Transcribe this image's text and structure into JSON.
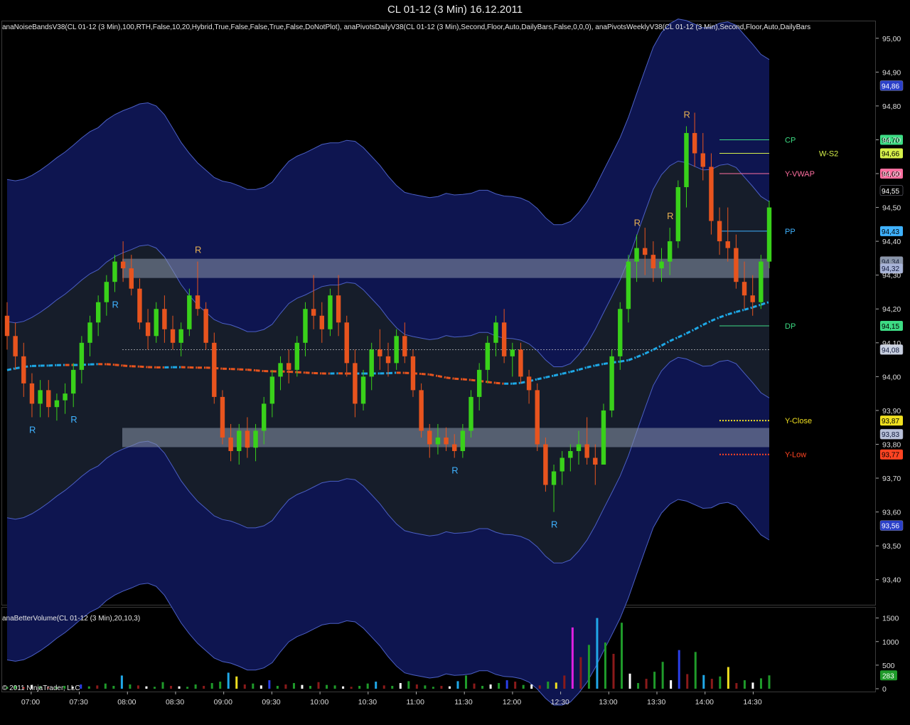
{
  "window": {
    "title": "CL 01-12 (3 Min)  16.12.2011"
  },
  "price_panel": {
    "indicator_label": "anaNoiseBandsV38(CL 01-12 (3 Min),100,RTH,False,10,20,Hybrid,True,False,False,True,False,DoNotPlot), anaPivotsDailyV38(CL 01-12 (3 Min),Second,Floor,Auto,DailyBars,False,0,0,0), anaPivotsWeeklyV38(CL 01-12 (3 Min),Second,Floor,Auto,DailyBars"
  },
  "volume_panel": {
    "indicator_label": "anaBetterVolume(CL 01-12 (3 Min),20,10,3)",
    "copyright": "© 2011 NinjaTrader, LLC"
  },
  "colors": {
    "background": "#000000",
    "band_fill": "#0e1550",
    "band_line": "#4b5fc4",
    "inner_fill": "#161d2a",
    "vwap_up": "#1ea8e6",
    "vwap_down": "#e8541e",
    "candle_up": "#39d11a",
    "candle_down": "#e8541e",
    "zone_fill": "#8a96aa"
  },
  "chart_data": [
    {
      "type": "candlestick",
      "panel": "price",
      "x_unit": "time",
      "x_ticks": [
        "07:00",
        "07:30",
        "08:00",
        "08:30",
        "09:00",
        "09:30",
        "10:00",
        "10:30",
        "11:00",
        "11:30",
        "12:00",
        "12:30",
        "13:00",
        "13:30",
        "14:00",
        "14:30"
      ],
      "y_ticks": [
        "95,00",
        "94,90",
        "94,80",
        "94,70",
        "94,60",
        "94,50",
        "94,40",
        "94,30",
        "94,20",
        "94,10",
        "94,00",
        "93,90",
        "93,80",
        "93,70",
        "93,60",
        "93,50",
        "93,40"
      ],
      "ylim": [
        93.33,
        95.05
      ],
      "xlim_minutes": [
        405,
        880
      ],
      "key_levels": [
        {
          "label": "CP",
          "value": 94.7,
          "price_tag": "94,70",
          "color": "#3ddc84",
          "style": "solid"
        },
        {
          "label": "W-S2",
          "value": 94.66,
          "price_tag": "94,66",
          "color": "#d6f04a",
          "style": "solid"
        },
        {
          "label": "Y-VWAP",
          "value": 94.6,
          "price_tag": "94,60",
          "color": "#ff6fa0",
          "style": "solid"
        },
        {
          "label": "PP",
          "value": 94.43,
          "price_tag": "94,43",
          "color": "#3fb2ff",
          "style": "solid"
        },
        {
          "label": "DP",
          "value": 94.15,
          "price_tag": "94,15",
          "color": "#3ddc84",
          "style": "solid"
        },
        {
          "label": "Y-Close",
          "value": 93.87,
          "price_tag": "93,87",
          "color": "#f0e020",
          "style": "dotted"
        },
        {
          "label": "Y-Low",
          "value": 93.77,
          "price_tag": "93,77",
          "color": "#ff4422",
          "style": "dotted"
        }
      ],
      "price_tags": [
        {
          "text": "94,86",
          "value": 94.86,
          "bg": "#2a3fc8",
          "fg": "#ffffff"
        },
        {
          "text": "94,55",
          "value": 94.55,
          "bg": "#000000",
          "fg": "#ffffff"
        },
        {
          "text": "94,34",
          "value": 94.34,
          "bg": "#8a96aa",
          "fg": "#1a2240"
        },
        {
          "text": "94,32",
          "value": 94.32,
          "bg": "#a8b4d8",
          "fg": "#10183a"
        },
        {
          "text": "94,08",
          "value": 94.08,
          "bg": "#c8d0e0",
          "fg": "#10183a"
        },
        {
          "text": "93,83",
          "value": 93.83,
          "bg": "#b8c0d8",
          "fg": "#10183a"
        },
        {
          "text": "93,56",
          "value": 93.56,
          "bg": "#2a3fc8",
          "fg": "#ffffff"
        }
      ],
      "zones": [
        {
          "from": 94.3,
          "to": 94.34
        },
        {
          "from": 93.8,
          "to": 93.84
        }
      ],
      "reference_line": 94.08,
      "series": [
        {
          "open": 94.18,
          "high": 94.22,
          "low": 94.08,
          "close": 94.12
        },
        {
          "open": 94.12,
          "high": 94.16,
          "low": 94.02,
          "close": 94.06
        },
        {
          "open": 94.06,
          "high": 94.1,
          "low": 93.94,
          "close": 93.98
        },
        {
          "open": 93.98,
          "high": 94.01,
          "low": 93.88,
          "close": 93.92
        },
        {
          "open": 93.92,
          "high": 93.99,
          "low": 93.88,
          "close": 93.96
        },
        {
          "open": 93.96,
          "high": 93.99,
          "low": 93.88,
          "close": 93.91
        },
        {
          "open": 93.91,
          "high": 93.95,
          "low": 93.87,
          "close": 93.93
        },
        {
          "open": 93.93,
          "high": 93.98,
          "low": 93.89,
          "close": 93.95
        },
        {
          "open": 93.95,
          "high": 94.04,
          "low": 93.91,
          "close": 94.02
        },
        {
          "open": 94.02,
          "high": 94.12,
          "low": 93.98,
          "close": 94.1
        },
        {
          "open": 94.1,
          "high": 94.18,
          "low": 94.06,
          "close": 94.16
        },
        {
          "open": 94.16,
          "high": 94.24,
          "low": 94.12,
          "close": 94.22
        },
        {
          "open": 94.22,
          "high": 94.3,
          "low": 94.18,
          "close": 94.28
        },
        {
          "open": 94.28,
          "high": 94.36,
          "low": 94.25,
          "close": 94.34
        },
        {
          "open": 94.34,
          "high": 94.4,
          "low": 94.28,
          "close": 94.32
        },
        {
          "open": 94.32,
          "high": 94.36,
          "low": 94.24,
          "close": 94.26
        },
        {
          "open": 94.26,
          "high": 94.29,
          "low": 94.14,
          "close": 94.16
        },
        {
          "open": 94.16,
          "high": 94.2,
          "low": 94.08,
          "close": 94.12
        },
        {
          "open": 94.12,
          "high": 94.22,
          "low": 94.1,
          "close": 94.2
        },
        {
          "open": 94.2,
          "high": 94.24,
          "low": 94.1,
          "close": 94.14
        },
        {
          "open": 94.14,
          "high": 94.18,
          "low": 94.08,
          "close": 94.1
        },
        {
          "open": 94.1,
          "high": 94.16,
          "low": 94.06,
          "close": 94.14
        },
        {
          "open": 94.14,
          "high": 94.26,
          "low": 94.12,
          "close": 94.24
        },
        {
          "open": 94.24,
          "high": 94.34,
          "low": 94.18,
          "close": 94.2
        },
        {
          "open": 94.2,
          "high": 94.22,
          "low": 94.08,
          "close": 94.1
        },
        {
          "open": 94.1,
          "high": 94.13,
          "low": 93.92,
          "close": 93.94
        },
        {
          "open": 93.94,
          "high": 93.96,
          "low": 93.8,
          "close": 93.82
        },
        {
          "open": 93.82,
          "high": 93.86,
          "low": 93.75,
          "close": 93.78
        },
        {
          "open": 93.78,
          "high": 93.86,
          "low": 93.74,
          "close": 93.84
        },
        {
          "open": 93.84,
          "high": 93.88,
          "low": 93.76,
          "close": 93.79
        },
        {
          "open": 93.79,
          "high": 93.86,
          "low": 93.75,
          "close": 93.84
        },
        {
          "open": 93.84,
          "high": 93.94,
          "low": 93.8,
          "close": 93.92
        },
        {
          "open": 93.92,
          "high": 94.02,
          "low": 93.88,
          "close": 94.0
        },
        {
          "open": 94.0,
          "high": 94.06,
          "low": 93.96,
          "close": 94.04
        },
        {
          "open": 94.04,
          "high": 94.08,
          "low": 93.98,
          "close": 94.02
        },
        {
          "open": 94.02,
          "high": 94.12,
          "low": 94.0,
          "close": 94.1
        },
        {
          "open": 94.1,
          "high": 94.22,
          "low": 94.06,
          "close": 94.2
        },
        {
          "open": 94.2,
          "high": 94.3,
          "low": 94.14,
          "close": 94.18
        },
        {
          "open": 94.18,
          "high": 94.22,
          "low": 94.1,
          "close": 94.14
        },
        {
          "open": 94.14,
          "high": 94.26,
          "low": 94.12,
          "close": 94.24
        },
        {
          "open": 94.24,
          "high": 94.3,
          "low": 94.12,
          "close": 94.16
        },
        {
          "open": 94.16,
          "high": 94.18,
          "low": 94.0,
          "close": 94.04
        },
        {
          "open": 94.04,
          "high": 94.08,
          "low": 93.88,
          "close": 93.92
        },
        {
          "open": 93.92,
          "high": 94.02,
          "low": 93.9,
          "close": 94.0
        },
        {
          "open": 94.0,
          "high": 94.1,
          "low": 93.96,
          "close": 94.08
        },
        {
          "open": 94.08,
          "high": 94.14,
          "low": 94.02,
          "close": 94.06
        },
        {
          "open": 94.06,
          "high": 94.1,
          "low": 94.0,
          "close": 94.04
        },
        {
          "open": 94.04,
          "high": 94.14,
          "low": 94.02,
          "close": 94.12
        },
        {
          "open": 94.12,
          "high": 94.16,
          "low": 94.04,
          "close": 94.06
        },
        {
          "open": 94.06,
          "high": 94.08,
          "low": 93.94,
          "close": 93.96
        },
        {
          "open": 93.96,
          "high": 93.98,
          "low": 93.82,
          "close": 93.84
        },
        {
          "open": 93.84,
          "high": 93.86,
          "low": 93.76,
          "close": 93.8
        },
        {
          "open": 93.8,
          "high": 93.86,
          "low": 93.77,
          "close": 93.82
        },
        {
          "open": 93.82,
          "high": 93.85,
          "low": 93.78,
          "close": 93.8
        },
        {
          "open": 93.8,
          "high": 93.83,
          "low": 93.76,
          "close": 93.78
        },
        {
          "open": 93.78,
          "high": 93.86,
          "low": 93.76,
          "close": 93.84
        },
        {
          "open": 93.84,
          "high": 93.96,
          "low": 93.82,
          "close": 93.94
        },
        {
          "open": 93.94,
          "high": 94.04,
          "low": 93.9,
          "close": 94.02
        },
        {
          "open": 94.02,
          "high": 94.12,
          "low": 93.98,
          "close": 94.1
        },
        {
          "open": 94.1,
          "high": 94.18,
          "low": 94.06,
          "close": 94.16
        },
        {
          "open": 94.16,
          "high": 94.2,
          "low": 94.04,
          "close": 94.06
        },
        {
          "open": 94.06,
          "high": 94.1,
          "low": 94.0,
          "close": 94.08
        },
        {
          "open": 94.08,
          "high": 94.1,
          "low": 93.98,
          "close": 94.0
        },
        {
          "open": 94.0,
          "high": 94.02,
          "low": 93.92,
          "close": 93.96
        },
        {
          "open": 93.96,
          "high": 93.98,
          "low": 93.78,
          "close": 93.8
        },
        {
          "open": 93.8,
          "high": 93.82,
          "low": 93.66,
          "close": 93.68
        },
        {
          "open": 93.68,
          "high": 93.74,
          "low": 93.6,
          "close": 93.72
        },
        {
          "open": 93.72,
          "high": 93.78,
          "low": 93.68,
          "close": 93.76
        },
        {
          "open": 93.76,
          "high": 93.8,
          "low": 93.72,
          "close": 93.78
        },
        {
          "open": 93.78,
          "high": 93.84,
          "low": 93.74,
          "close": 93.8
        },
        {
          "open": 93.8,
          "high": 93.88,
          "low": 93.74,
          "close": 93.76
        },
        {
          "open": 93.76,
          "high": 93.8,
          "low": 93.68,
          "close": 93.74
        },
        {
          "open": 93.74,
          "high": 93.92,
          "low": 93.74,
          "close": 93.9
        },
        {
          "open": 93.9,
          "high": 94.08,
          "low": 93.88,
          "close": 94.06
        },
        {
          "open": 94.06,
          "high": 94.22,
          "low": 94.02,
          "close": 94.2
        },
        {
          "open": 94.2,
          "high": 94.36,
          "low": 94.16,
          "close": 94.34
        },
        {
          "open": 94.34,
          "high": 94.42,
          "low": 94.28,
          "close": 94.38
        },
        {
          "open": 94.38,
          "high": 94.44,
          "low": 94.3,
          "close": 94.36
        },
        {
          "open": 94.36,
          "high": 94.4,
          "low": 94.28,
          "close": 94.32
        },
        {
          "open": 94.32,
          "high": 94.38,
          "low": 94.28,
          "close": 94.34
        },
        {
          "open": 94.34,
          "high": 94.44,
          "low": 94.3,
          "close": 94.4
        },
        {
          "open": 94.4,
          "high": 94.58,
          "low": 94.38,
          "close": 94.56
        },
        {
          "open": 94.56,
          "high": 94.74,
          "low": 94.5,
          "close": 94.72
        },
        {
          "open": 94.72,
          "high": 94.78,
          "low": 94.62,
          "close": 94.66
        },
        {
          "open": 94.66,
          "high": 94.72,
          "low": 94.58,
          "close": 94.62
        },
        {
          "open": 94.62,
          "high": 94.66,
          "low": 94.42,
          "close": 94.46
        },
        {
          "open": 94.46,
          "high": 94.5,
          "low": 94.36,
          "close": 94.4
        },
        {
          "open": 94.4,
          "high": 94.5,
          "low": 94.34,
          "close": 94.38
        },
        {
          "open": 94.38,
          "high": 94.42,
          "low": 94.26,
          "close": 94.28
        },
        {
          "open": 94.28,
          "high": 94.34,
          "low": 94.2,
          "close": 94.24
        },
        {
          "open": 94.24,
          "high": 94.3,
          "low": 94.18,
          "close": 94.22
        },
        {
          "open": 94.22,
          "high": 94.36,
          "low": 94.2,
          "close": 94.34
        },
        {
          "open": 94.34,
          "high": 94.52,
          "low": 94.32,
          "close": 94.5
        }
      ],
      "reversal_markers": [
        {
          "label": "R",
          "bar": 3,
          "position": "below",
          "color": "#3fb2ff"
        },
        {
          "label": "R",
          "bar": 8,
          "position": "below",
          "color": "#3fb2ff"
        },
        {
          "label": "R",
          "bar": 13,
          "position": "below",
          "color": "#3fb2ff"
        },
        {
          "label": "R",
          "bar": 23,
          "position": "above",
          "color": "#e6b052"
        },
        {
          "label": "R",
          "bar": 54,
          "position": "below",
          "color": "#3fb2ff"
        },
        {
          "label": "R",
          "bar": 66,
          "position": "below",
          "color": "#3fb2ff"
        },
        {
          "label": "R",
          "bar": 76,
          "position": "above",
          "color": "#e6b052"
        },
        {
          "label": "R",
          "bar": 80,
          "position": "above",
          "color": "#e6b052"
        },
        {
          "label": "R",
          "bar": 82,
          "position": "above",
          "color": "#e6b052"
        }
      ]
    },
    {
      "type": "bar",
      "panel": "volume",
      "y_ticks": [
        "1500",
        "1000",
        "500",
        "0"
      ],
      "ylim": [
        0,
        1600
      ],
      "last_value_tag": "283",
      "values": [
        40,
        60,
        30,
        80,
        50,
        40,
        35,
        60,
        45,
        90,
        50,
        70,
        110,
        60,
        280,
        90,
        70,
        50,
        40,
        140,
        60,
        50,
        40,
        90,
        60,
        120,
        150,
        340,
        260,
        90,
        110,
        70,
        180,
        60,
        90,
        120,
        80,
        60,
        140,
        80,
        70,
        50,
        40,
        60,
        110,
        150,
        70,
        60,
        120,
        160,
        90,
        70,
        40,
        60,
        50,
        160,
        280,
        110,
        60,
        90,
        120,
        180,
        150,
        80,
        90,
        70,
        150,
        130,
        280,
        1300,
        670,
        930,
        1500,
        980,
        740,
        1400,
        320,
        120,
        210,
        360,
        570,
        180,
        820,
        310,
        780,
        290,
        210,
        260,
        460,
        120,
        180,
        130,
        220,
        283
      ],
      "colors": [
        "#1f9a2a",
        "#1f9a2a",
        "#e02020",
        "#ffffff",
        "#1f9a2a",
        "#8a1a1a",
        "#1f9a2a",
        "#1f9a2a",
        "#ffffff",
        "#2a3fe8",
        "#1f9a2a",
        "#8a1a1a",
        "#1f9a2a",
        "#1f9a2a",
        "#20a8e8",
        "#1f9a2a",
        "#8a1a1a",
        "#ffffff",
        "#1f9a2a",
        "#1f9a2a",
        "#8a1a1a",
        "#ffffff",
        "#1f9a2a",
        "#1f9a2a",
        "#8a1a1a",
        "#1f9a2a",
        "#1f9a2a",
        "#20a8e8",
        "#f0e020",
        "#8a1a1a",
        "#1f9a2a",
        "#ffffff",
        "#2a3fe8",
        "#1f9a2a",
        "#8a1a1a",
        "#1f9a2a",
        "#ffffff",
        "#1f9a2a",
        "#8a1a1a",
        "#1f9a2a",
        "#1f9a2a",
        "#ffffff",
        "#8a1a1a",
        "#1f9a2a",
        "#1f9a2a",
        "#20a8e8",
        "#8a1a1a",
        "#1f9a2a",
        "#ffffff",
        "#1f9a2a",
        "#8a1a1a",
        "#1f9a2a",
        "#1f9a2a",
        "#8a1a1a",
        "#ffffff",
        "#20a8e8",
        "#1f9a2a",
        "#8a1a1a",
        "#1f9a2a",
        "#ffffff",
        "#1f9a2a",
        "#2a3fe8",
        "#8a1a1a",
        "#1f9a2a",
        "#ffffff",
        "#8a1a1a",
        "#1f9a2a",
        "#f0e020",
        "#8a1a1a",
        "#e020e0",
        "#8a1a1a",
        "#1f9a2a",
        "#20a8e8",
        "#1f9a2a",
        "#8a1a1a",
        "#1f9a2a",
        "#ffffff",
        "#1f9a2a",
        "#8a1a1a",
        "#1f9a2a",
        "#1f9a2a",
        "#ffffff",
        "#2a3fe8",
        "#8a1a1a",
        "#1f9a2a",
        "#20a8e8",
        "#8a1a1a",
        "#1f9a2a",
        "#f0e020",
        "#8a1a1a",
        "#1f9a2a",
        "#ffffff",
        "#1f9a2a",
        "#1f9a2a"
      ]
    }
  ]
}
